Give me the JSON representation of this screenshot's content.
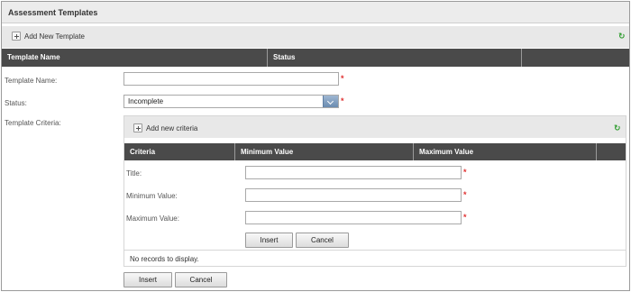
{
  "header": {
    "title": "Assessment Templates"
  },
  "toolbar": {
    "add_label": "Add New Template",
    "refresh_icon": "refresh-icon"
  },
  "grid": {
    "columns": [
      "Template Name",
      "Status",
      ""
    ]
  },
  "form": {
    "template_name_label": "Template Name:",
    "template_name_value": "",
    "status_label": "Status:",
    "status_value": "Incomplete",
    "criteria_label": "Template Criteria:",
    "required_mark": "*"
  },
  "criteria": {
    "add_label": "Add new criteria",
    "columns": [
      "Criteria",
      "Minimum Value",
      "Maximum Value",
      ""
    ],
    "title_label": "Title:",
    "min_label": "Minimum Value:",
    "max_label": "Maximum Value:",
    "insert_label": "Insert",
    "cancel_label": "Cancel",
    "no_records": "No records to display."
  },
  "footer": {
    "insert_label": "Insert",
    "cancel_label": "Cancel"
  },
  "colors": {
    "header_bg": "#4a4a4a",
    "required": "#e03030",
    "refresh": "#2a9b2a"
  }
}
